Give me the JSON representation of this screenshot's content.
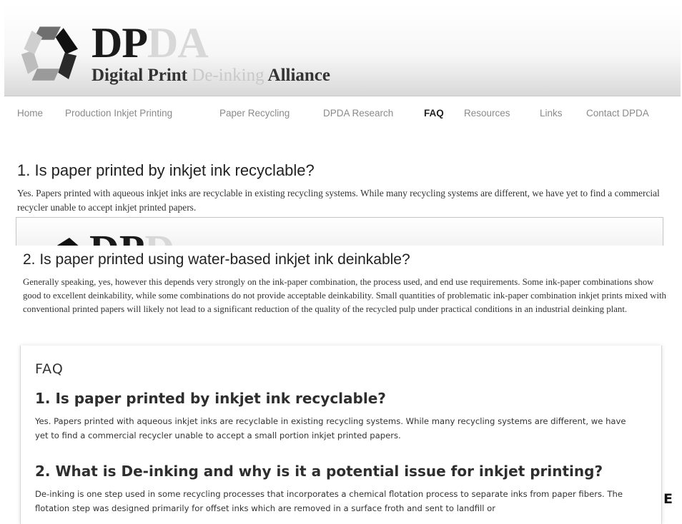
{
  "header": {
    "brand_dp": "DP",
    "brand_da": "DA",
    "tagline_a": "Digital Print ",
    "tagline_b": "De-inking",
    "tagline_c": " Alliance",
    "logo_icon": "recycle-arrows-icon"
  },
  "nav": {
    "items": [
      {
        "label": "Home"
      },
      {
        "label": "Production Inkjet Printing"
      },
      {
        "label": "Paper Recycling"
      },
      {
        "label": "DPDA Research"
      },
      {
        "label": "FAQ",
        "active": true
      },
      {
        "label": "Resources"
      },
      {
        "label": "Links"
      },
      {
        "label": "Contact DPDA"
      }
    ]
  },
  "section1": {
    "title": "1. Is paper printed by inkjet ink recyclable?",
    "text": "Yes. Papers printed with aqueous inkjet inks are recyclable in existing recycling systems. While many recycling systems are different, we have yet to find a commercial recycler unable to accept inkjet printed papers."
  },
  "banner_fragment": {
    "dp": "DP",
    "da": "D"
  },
  "section2": {
    "title": "2. Is paper printed using water-based inkjet ink deinkable?",
    "text": "Generally speaking, yes, however this depends very strongly on the ink-paper combination, the process used, and end use requirements. Some ink-paper combinations show good to excellent deinkability, while some combinations do not provide acceptable deinkability. Small quantities of problematic ink-paper combination inkjet prints mixed with conventional printed papers will likely not lead to a significant reduction of the quality of the recycled pulp under practical conditions in an industrial deinking plant."
  },
  "faq_card": {
    "heading": "FAQ",
    "q1": "1. Is paper printed by inkjet ink recyclable?",
    "a1": "Yes. Papers printed with aqueous inkjet inks are recyclable in existing recycling systems. While many recycling systems are different, we have yet to find a commercial recycler unable to accept a small portion inkjet printed papers.",
    "q2": "2. What is De-inking and why is it a potential issue for inkjet printing?",
    "a2": "De-inking is one step used in some recycling processes that incorporates a chemical flotation process to separate inks from paper fibers. The flotation step was designed primarily for offset inks which are removed in a surface froth and sent to landfill or"
  },
  "edge_letter": "E"
}
